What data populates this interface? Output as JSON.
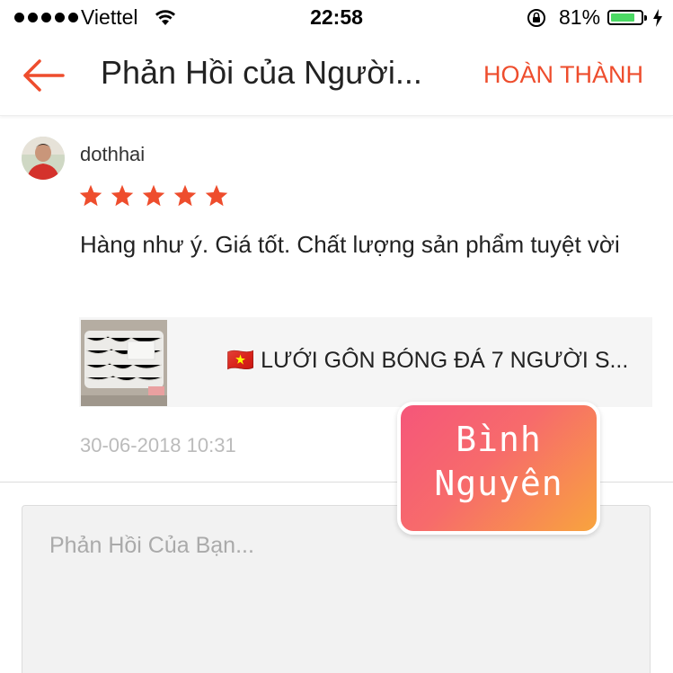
{
  "status_bar": {
    "carrier": "Viettel",
    "time": "22:58",
    "battery_percent": "81%",
    "battery_level": 0.81,
    "icons": [
      "signal-dots-icon",
      "wifi-icon",
      "orientation-lock-icon",
      "battery-icon",
      "charging-bolt-icon"
    ]
  },
  "nav": {
    "title": "Phản Hồi của Người...",
    "done_label": "HOÀN THÀNH",
    "back_icon": "back-arrow-icon"
  },
  "review": {
    "username": "dothhai",
    "rating": 5,
    "rating_max": 5,
    "text": "Hàng như ý. Giá tốt.  Chất lượng sản phẩm tuyệt vời",
    "product_name": "🇻🇳 LƯỚI GÔN BÓNG ĐÁ 7 NGƯỜI S...",
    "date": "30-06-2018 10:31"
  },
  "reply": {
    "placeholder": "Phản Hồi Của Bạn..."
  },
  "watermark": {
    "line1": "Bình",
    "line2": "Nguyên"
  },
  "colors": {
    "accent": "#ee4d2d",
    "star": "#ee4d2d",
    "date": "#bbbbbb",
    "battery_fill": "#4cd964"
  }
}
